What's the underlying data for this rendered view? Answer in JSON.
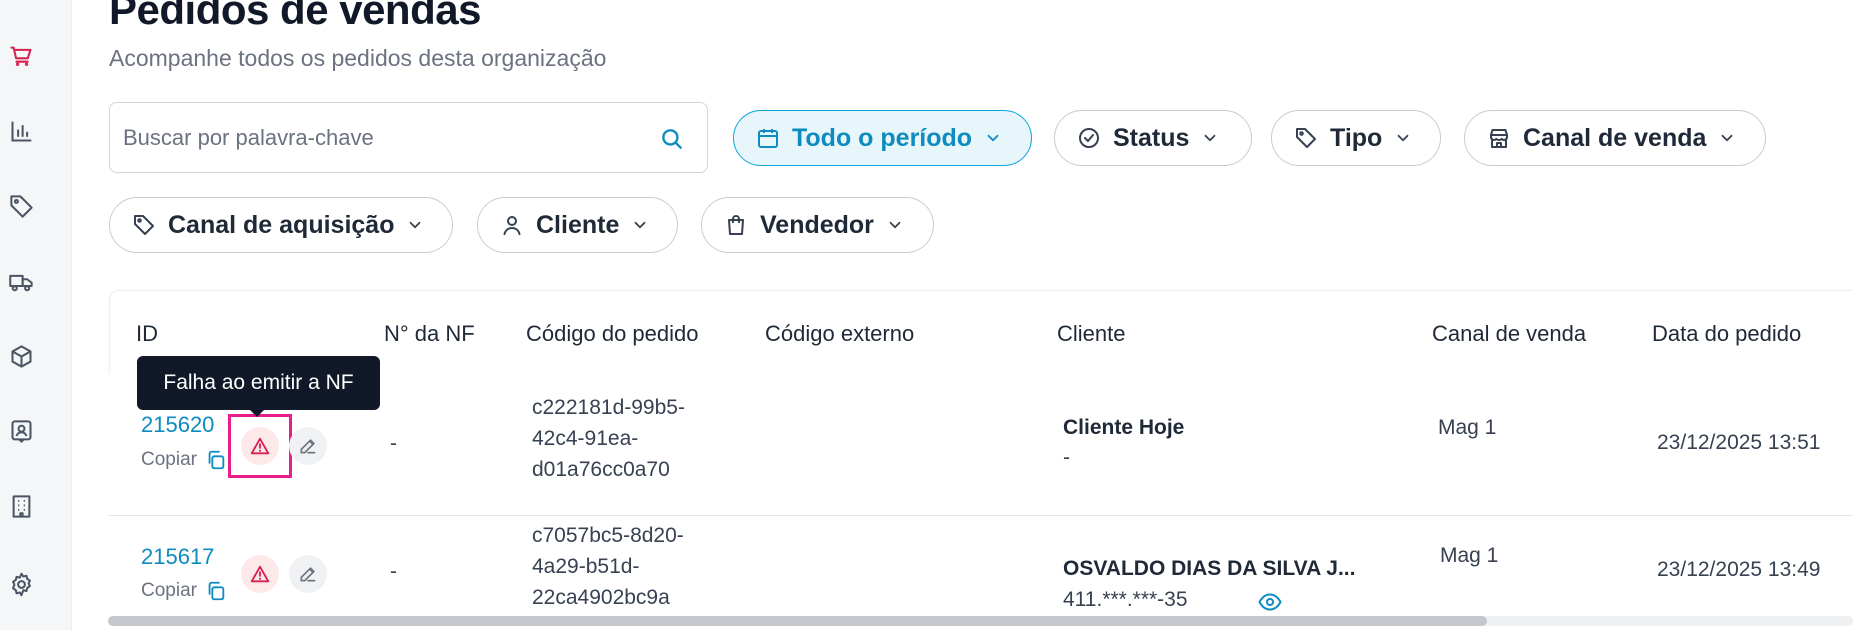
{
  "colors": {
    "accent": "#0e8cc0",
    "sidebar_active": "#d6204f",
    "warning": "#d6204f",
    "highlight": "#e91e8c"
  },
  "sidebar": {
    "items": [
      {
        "icon": "cart-icon",
        "active": true
      },
      {
        "icon": "bar-chart-icon",
        "active": false
      },
      {
        "icon": "tag-icon",
        "active": false
      },
      {
        "icon": "truck-icon",
        "active": false
      },
      {
        "icon": "box-icon",
        "active": false
      },
      {
        "icon": "contact-icon",
        "active": false
      },
      {
        "icon": "building-icon",
        "active": false
      },
      {
        "icon": "gear-icon",
        "active": false
      }
    ]
  },
  "header": {
    "title": "Pedidos de vendas",
    "subtitle": "Acompanhe todos os pedidos desta organização"
  },
  "search": {
    "placeholder": "Buscar por palavra-chave",
    "icon": "search-icon"
  },
  "filters": [
    {
      "label": "Todo o período",
      "icon": "calendar-icon",
      "active": true
    },
    {
      "label": "Status",
      "icon": "check-circle-icon",
      "active": false
    },
    {
      "label": "Tipo",
      "icon": "tag-icon",
      "active": false
    },
    {
      "label": "Canal de venda",
      "icon": "store-icon",
      "active": false
    },
    {
      "label": "Canal de aquisição",
      "icon": "tag-icon",
      "active": false
    },
    {
      "label": "Cliente",
      "icon": "user-icon",
      "active": false
    },
    {
      "label": "Vendedor",
      "icon": "shopping-bag-icon",
      "active": false
    }
  ],
  "table": {
    "columns": [
      "ID",
      "N° da NF",
      "Código do pedido",
      "Código externo",
      "Cliente",
      "Canal de venda",
      "Data do pedido"
    ],
    "copy_label": "Copiar",
    "rows": [
      {
        "id": "215620",
        "nf": "-",
        "order_code": [
          "c222181d-99b5-",
          "42c4-91ea-",
          "d01a76cc0a70"
        ],
        "external_code": "",
        "client_name": "Cliente Hoje",
        "client_doc": "-",
        "sales_channel": "Mag 1",
        "date": "23/12/2025 13:51"
      },
      {
        "id": "215617",
        "nf": "-",
        "order_code": [
          "c7057bc5-8d20-",
          "4a29-b51d-",
          "22ca4902bc9a"
        ],
        "external_code": "",
        "client_name": "OSVALDO DIAS DA SILVA J...",
        "client_doc": "411.***.***-35",
        "sales_channel": "Mag 1",
        "date": "23/12/2025 13:49"
      }
    ]
  },
  "tooltip": {
    "text": "Falha ao emitir a NF"
  },
  "scrollbar": {
    "position_fraction": 0.0,
    "visible_fraction": 0.79
  }
}
